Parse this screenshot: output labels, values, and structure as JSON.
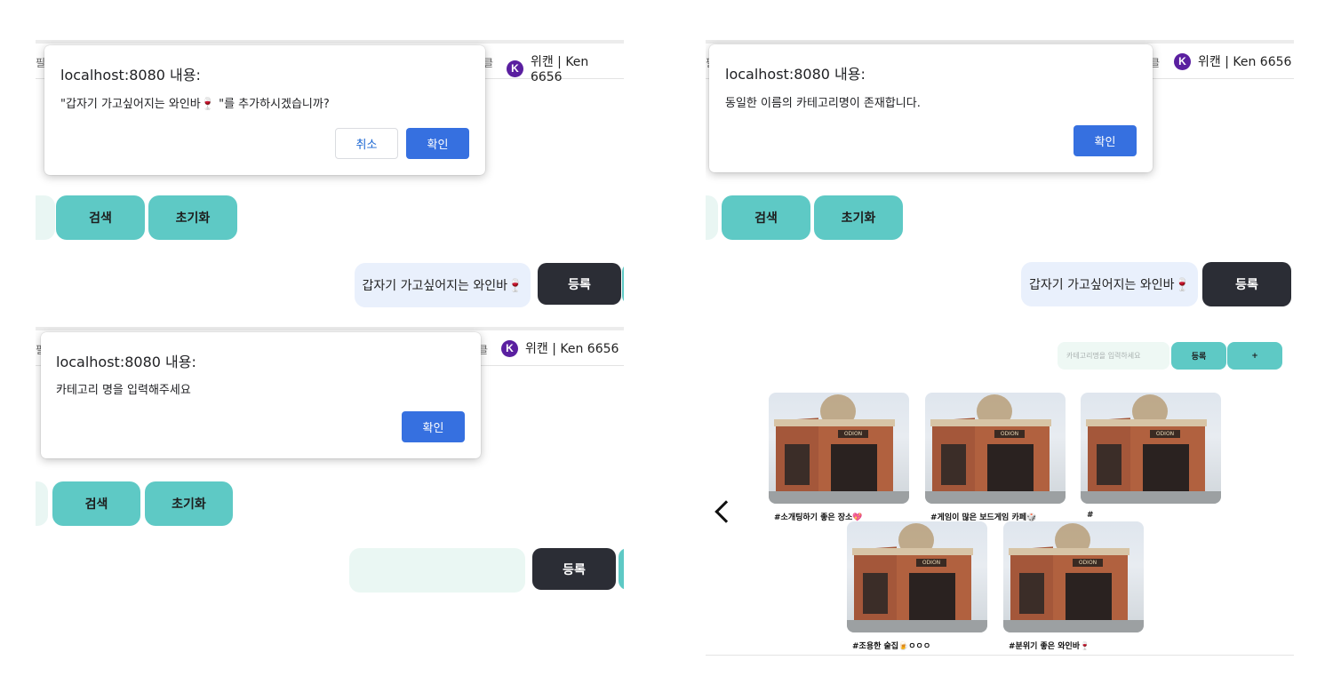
{
  "navbar": {
    "left_fragment_1": "필름",
    "right_fragment_1": "클",
    "left_fragment_2": "필",
    "right_fragment_2": "클",
    "left_fragment_3": "필",
    "right_fragment_3": "클",
    "user_logo_letter": "K",
    "user_label": "위캔 | Ken 6656"
  },
  "actions": {
    "search_label": "검색",
    "reset_label": "초기화",
    "register_label": "등록"
  },
  "category_form": {
    "value": "갑자기 가고싶어지는 와인바🍷"
  },
  "dialogs": {
    "confirm_add": {
      "title": "localhost:8080 내용:",
      "message": "\"갑자기 가고싶어지는 와인바🍷 \"를 추가하시겠습니까?",
      "cancel_label": "취소",
      "ok_label": "확인"
    },
    "empty_name": {
      "title": "localhost:8080 내용:",
      "message": "카테고리 명을 입력해주세요",
      "ok_label": "확인"
    },
    "duplicate": {
      "title": "localhost:8080 내용:",
      "message": "동일한 이름의 카테고리명이 존재합니다.",
      "ok_label": "확인"
    }
  },
  "category_panel": {
    "placeholder": "카테고리명을 입력하세요",
    "register_label": "등록",
    "add_label": "+",
    "items": [
      {
        "caption": "#소개팅하기 좋은 장소💖"
      },
      {
        "caption": "#게임이 많은 보드게임 카페🎲"
      },
      {
        "caption": "#"
      },
      {
        "caption": "#조용한 술집🍺ㅇㅇㅇ"
      },
      {
        "caption": "#분위기 좋은 와인바🍷"
      }
    ],
    "photo_sign": "ODION"
  },
  "icons": {
    "back": "chevron-left-icon"
  }
}
